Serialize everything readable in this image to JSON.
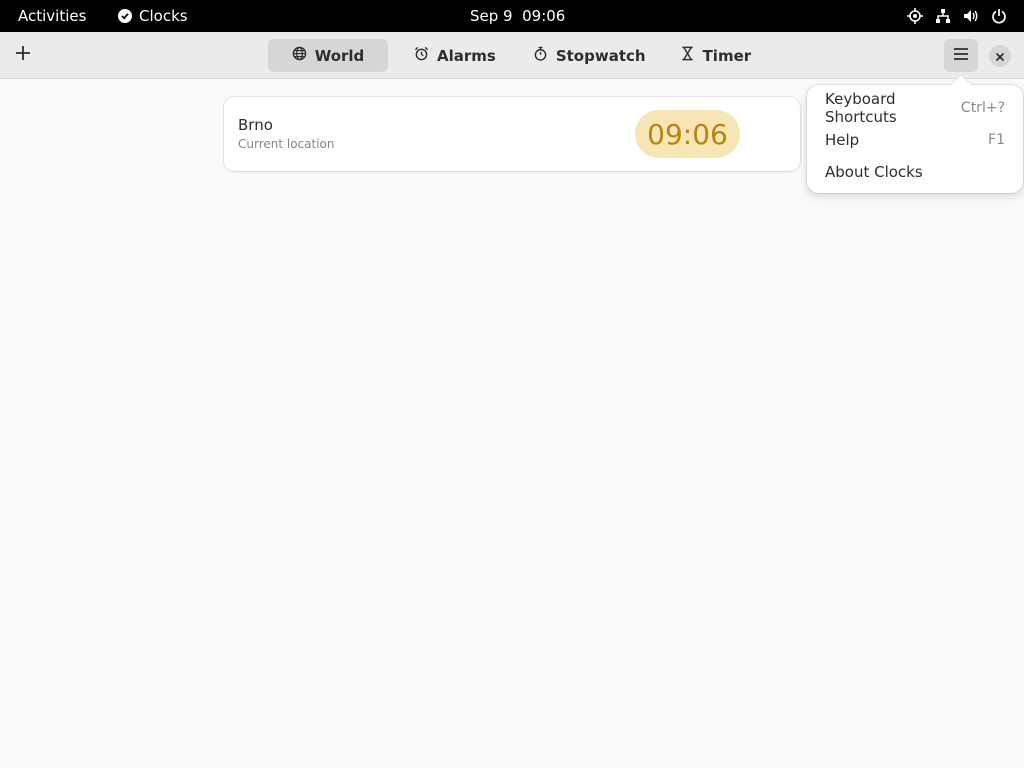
{
  "topbar": {
    "activities": "Activities",
    "app_name": "Clocks",
    "clock": "Sep 9  09:06",
    "tray_icons": [
      "location-icon",
      "network-icon",
      "volume-icon",
      "power-icon"
    ]
  },
  "header": {
    "add_icon": "plus-icon",
    "tabs": [
      {
        "label": "World",
        "icon": "globe-icon",
        "active": true
      },
      {
        "label": "Alarms",
        "icon": "alarm-icon",
        "active": false
      },
      {
        "label": "Stopwatch",
        "icon": "stopwatch-icon",
        "active": false
      },
      {
        "label": "Timer",
        "icon": "hourglass-icon",
        "active": false
      }
    ],
    "menu_icon": "hamburger-icon",
    "close_icon": "close-icon"
  },
  "world": {
    "locations": [
      {
        "city": "Brno",
        "subtitle": "Current location",
        "time": "09:06"
      }
    ]
  },
  "menu": {
    "items": [
      {
        "label": "Keyboard Shortcuts",
        "accel": "Ctrl+?"
      },
      {
        "label": "Help",
        "accel": "F1"
      },
      {
        "label": "About Clocks",
        "accel": ""
      }
    ]
  },
  "colors": {
    "topbar_bg": "#000000",
    "headerbar_bg": "#ebebeb",
    "page_bg": "#fafafa",
    "time_pill_bg": "#f8e5b6",
    "time_pill_text": "#b8860b"
  }
}
